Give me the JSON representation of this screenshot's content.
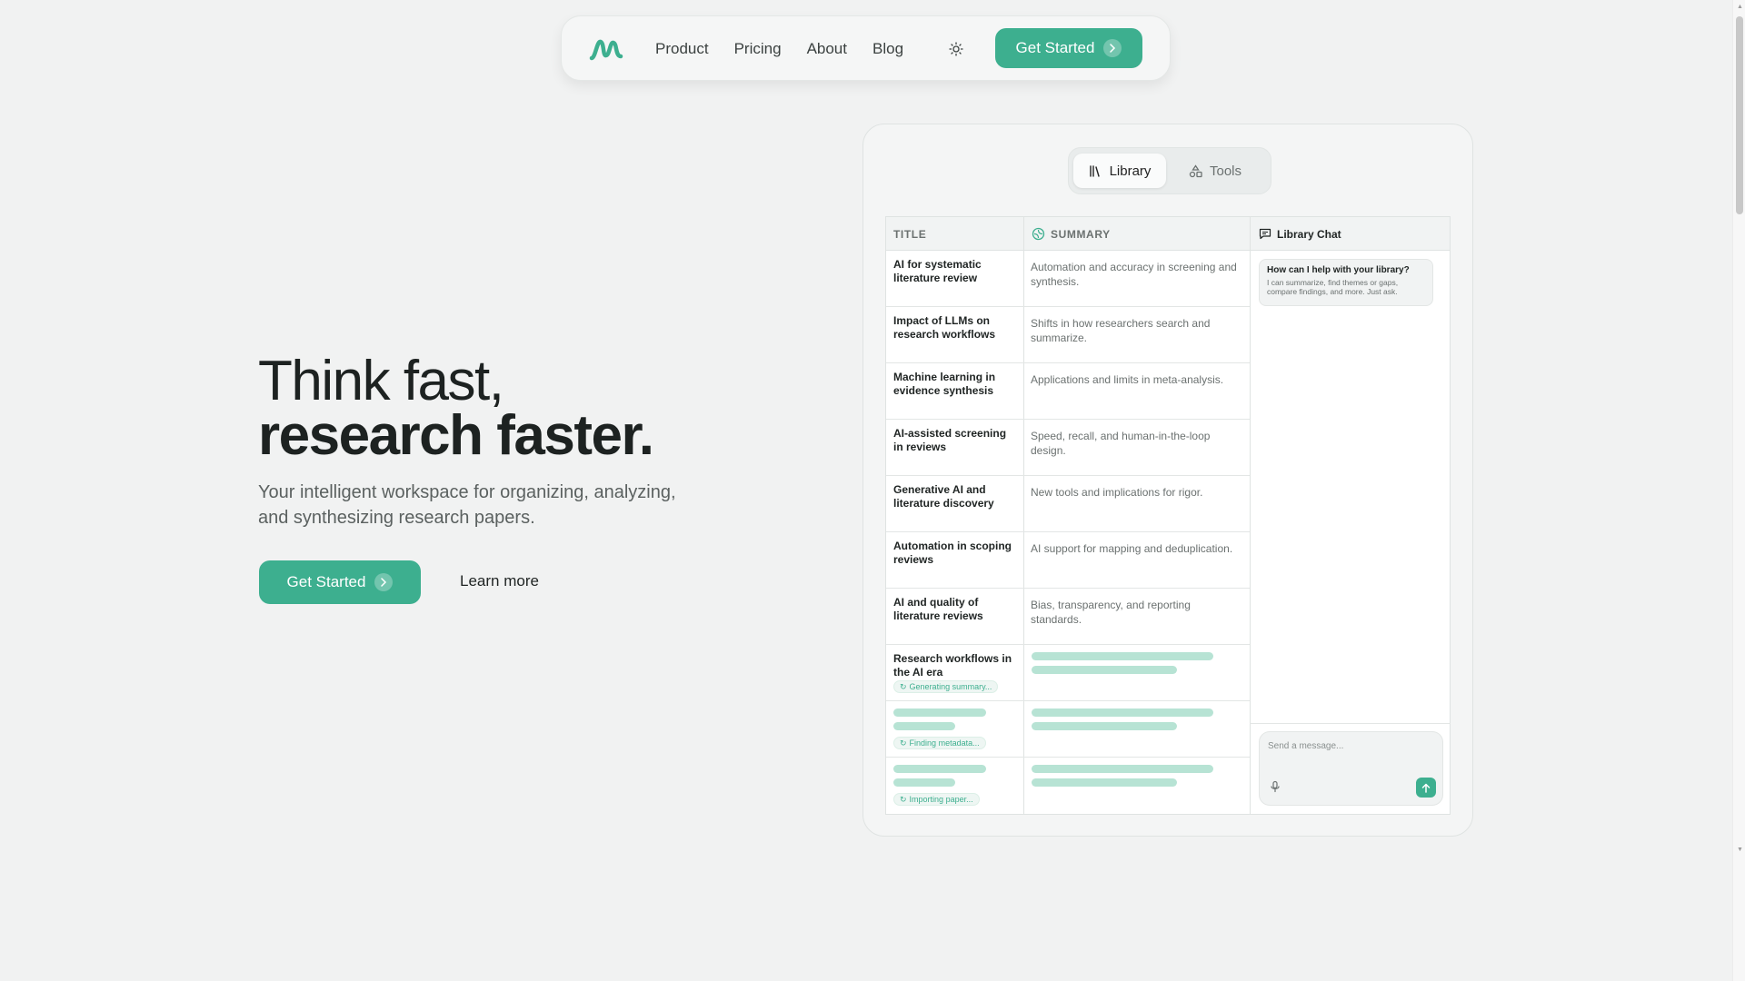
{
  "nav": {
    "links": [
      "Product",
      "Pricing",
      "About",
      "Blog"
    ],
    "cta_label": "Get Started"
  },
  "hero": {
    "title_line1": "Think fast,",
    "title_line2": "research faster.",
    "subtitle": "Your intelligent workspace for organizing, analyzing, and synthesizing research papers.",
    "cta_label": "Get Started",
    "learn_more": "Learn more"
  },
  "app": {
    "tabs": [
      {
        "label": "Library",
        "active": true
      },
      {
        "label": "Tools",
        "active": false
      }
    ],
    "columns": {
      "title": "TITLE",
      "summary": "SUMMARY",
      "chat": "Library Chat"
    },
    "rows": [
      {
        "title": "AI for systematic literature review",
        "summary": "Automation and accuracy in screening and synthesis."
      },
      {
        "title": "Impact of LLMs on research workflows",
        "summary": "Shifts in how researchers search and summarize."
      },
      {
        "title": "Machine learning in evidence synthesis",
        "summary": "Applications and limits in meta-analysis."
      },
      {
        "title": "AI-assisted screening in reviews",
        "summary": "Speed, recall, and human-in-the-loop design."
      },
      {
        "title": "Generative AI and literature discovery",
        "summary": "New tools and implications for rigor."
      },
      {
        "title": "Automation in scoping reviews",
        "summary": "AI support for mapping and deduplication."
      },
      {
        "title": "AI and quality of literature reviews",
        "summary": "Bias, transparency, and reporting standards."
      },
      {
        "title": "Research workflows in the AI era",
        "summary": "",
        "status": "Generating summary..."
      },
      {
        "title": "",
        "summary": "",
        "status": "Finding metadata..."
      },
      {
        "title": "",
        "summary": "",
        "status": "Importing paper..."
      }
    ],
    "chat": {
      "question": "How can I help with your library?",
      "answer": "I can summarize, find themes or gaps, compare findings, and more. Just ask.",
      "input_placeholder": "Send a message..."
    }
  },
  "colors": {
    "accent": "#3daf8f",
    "background": "#f1f2f2",
    "skeleton": "#b7e3d4"
  },
  "icons": [
    "logo-icon",
    "sun-icon",
    "chevron-right-icon",
    "library-icon",
    "tools-icon",
    "ai-sparkle-icon",
    "chat-icon",
    "spinner-icon",
    "mic-icon",
    "send-arrow-icon"
  ]
}
